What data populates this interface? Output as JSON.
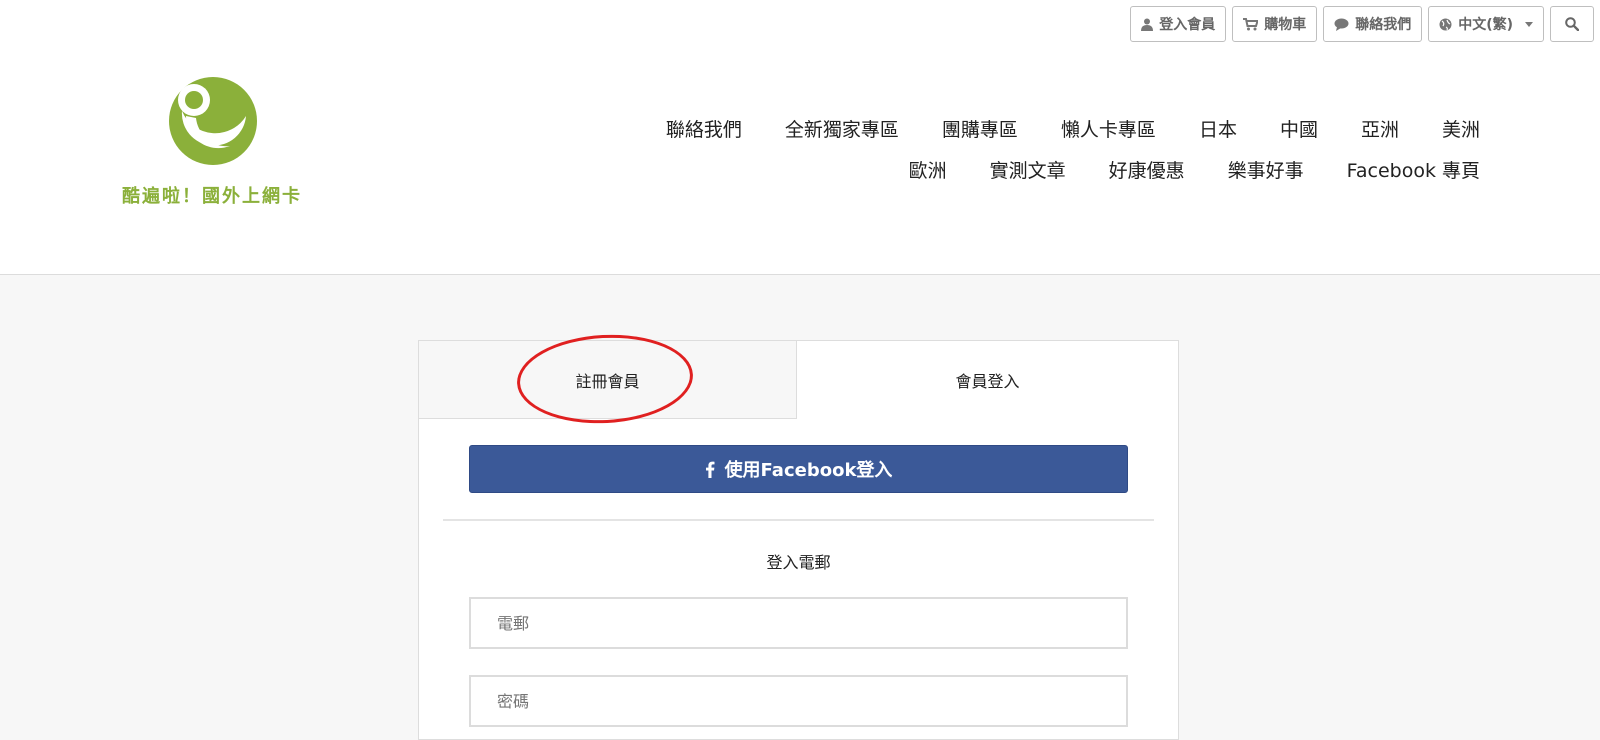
{
  "util_bar": {
    "login_label": "登入會員",
    "cart_label": "購物車",
    "contact_label": "聯絡我們",
    "language_label": "中文(繁)"
  },
  "logo": {
    "text": "酷遍啦！國外上網卡",
    "color": "#8bb03a"
  },
  "nav": {
    "row1": [
      "聯絡我們",
      "全新獨家專區",
      "團購專區",
      "懶人卡專區",
      "日本",
      "中國",
      "亞洲",
      "美洲"
    ],
    "row2": [
      "歐洲",
      "實測文章",
      "好康優惠",
      "樂事好事",
      "Facebook 專頁"
    ]
  },
  "tabs": {
    "register": "註冊會員",
    "login": "會員登入"
  },
  "facebook": {
    "label": "使用Facebook登入",
    "color": "#3b5998"
  },
  "form": {
    "email_section_label": "登入電郵",
    "email_placeholder": "電郵",
    "password_placeholder": "密碼"
  },
  "annotation_color": "#e02020"
}
